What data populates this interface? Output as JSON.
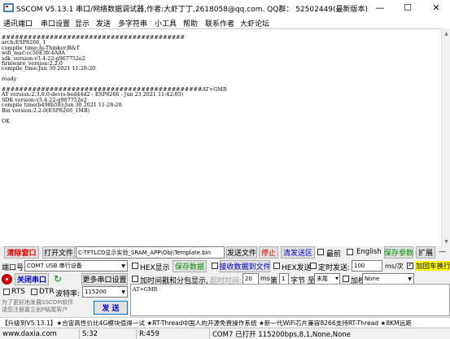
{
  "window": {
    "title": "SSCOM V5.13.1 串口/网络数据调试器,作者:大虾丁丁,2618058@qq.com. QQ群： 52502449(最新版本)",
    "minimize_glyph": "—",
    "maximize_glyph": "☐",
    "close_glyph": "✕"
  },
  "menu": {
    "items": [
      "通讯端口",
      "串口设置",
      "显示",
      "发送",
      "多字符串",
      "小工具",
      "帮助",
      "联系作者",
      "大虾论坛"
    ]
  },
  "receive": {
    "text": "##########################################\narch:ESP8266, 1\ncompile_time:Ai-Thinker|B&T\nwifi_mac:cc50E3fc4A8A\nsdk_version:v3.4-22-g967752e2\nfirmware_version:2.2.0\ncompile_time:Jun 30 2021 11:28:20\n\nready\n\n##############################################AT+GMR\nAT version:2.3.0.0-dev(s-bed44d2 - ESP8266 - Jun 23 2021 11:42:05)\nSDK version:v3.4-22-g967752e2\ncompile time(b498b58):Jun 30 2021 11:28:20\nBin version:2.2.0(ESP8266_1MB)\n\nOK"
  },
  "toolbar1": {
    "clear_window": "清除窗口",
    "open_file": "打开文件",
    "file_path": "C-TFTLCD显示实验_SRAM_APP\\Obj\\Template.bin",
    "send_file": "发送文件",
    "stop": "停止",
    "clear_send": "清发送区",
    "topmost": "最前",
    "english": "English",
    "save_params": "保存参数",
    "expand": "扩展",
    "collapse_glyph": "—"
  },
  "toolbar2": {
    "port_label": "端口号",
    "port_value": "COM7 USB 串行设备",
    "hex_display": "HEX显示",
    "save_data": "保存数据",
    "recv_to_file": "接收数据到文件",
    "hex_send": "HEX发送",
    "timed_send": "定时发送:",
    "interval_value": "100",
    "interval_unit": "ms/次",
    "add_crlf": "加回车换行"
  },
  "toolbar3": {
    "close_port": "关闭串口",
    "more_settings": "更多串口设置",
    "add_timestamp": "加时间戳和分包显示,",
    "timeout_label": "超时时间:",
    "timeout_value": "20",
    "timeout_unit": "ms",
    "page_label": "第",
    "byte_value": "1",
    "byte_label": "字节 至",
    "end_select": "末尾",
    "checksum_label": "加校验",
    "checksum_value": "None"
  },
  "toolbar4": {
    "rts": "RTS",
    "dtr": "DTR",
    "baud_label": "波特率:",
    "baud_value": "115200"
  },
  "send": {
    "text": "AT+GMR",
    "send_button": "发 送",
    "promo_text": "为了更好地发展SSCOM软件\n请您注册嘉立创P结尾客户"
  },
  "ticker": {
    "text": "【升级到V5.13.1】★合宙高性价比4G模块值得一试 ★RT-Thread中国人的开源免费操作系统 ★新一代WiFi芯片兼容8266支持RT-Thread ★8KM远距"
  },
  "status": {
    "url": "www.daxia.com",
    "sent": "S:32",
    "received": "R:459",
    "port_status": "COM7 已打开  115200bps,8,1,None,None"
  },
  "colors": {
    "red_accent": "#e00000",
    "green_accent": "#009000",
    "blue_link": "#0000cc",
    "checked_crlf": "#ffff00"
  }
}
